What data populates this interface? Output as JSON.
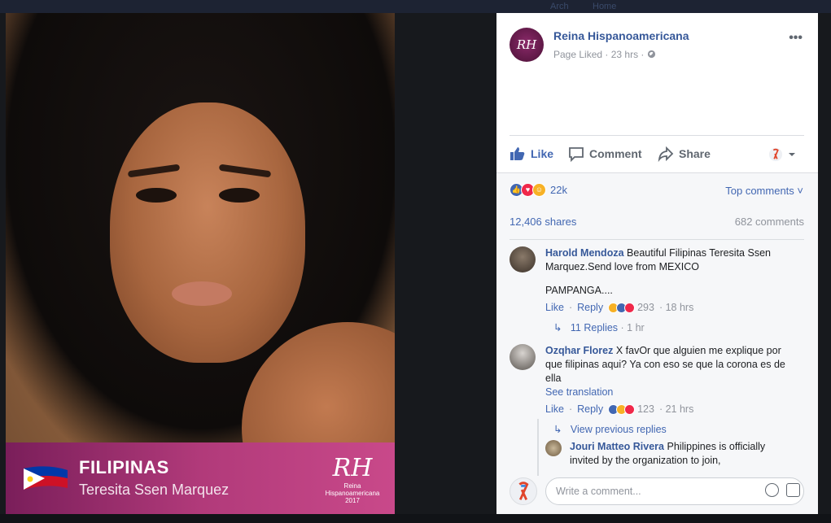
{
  "topbar": {
    "user": "Arch",
    "home": "Home"
  },
  "photo": {
    "country": "FILIPINAS",
    "person": "Teresita Ssen Marquez",
    "watermark": {
      "mono": "RH",
      "brand": "Reina Hispanoamericana",
      "year": "2017"
    }
  },
  "post": {
    "page_name": "Reina Hispanoamericana",
    "page_avatar_text": "RH",
    "meta": "Page Liked · 23 hrs · ",
    "more_label": "•••"
  },
  "actions": {
    "like": "Like",
    "comment": "Comment",
    "share": "Share"
  },
  "reactions": {
    "count": "22k",
    "top_comments": "Top comments ˅"
  },
  "counts": {
    "shares": "12,406 shares",
    "comments": "682 comments"
  },
  "comments": [
    {
      "name": "Harold Mendoza",
      "text": "Beautiful Filipinas Teresita Ssen Marquez.Send love from MEXICO",
      "text2": "PAMPANGA....",
      "like": "Like",
      "reply": "Reply",
      "reactions": "293",
      "time": "· 18 hrs",
      "replies": "11 Replies",
      "replies_time": "· 1 hr"
    },
    {
      "name": "Ozqhar Florez",
      "text": "X favOr que alguien me explique por que filipinas aqui? Ya con eso se que la corona es de ella",
      "see_translation": "See translation",
      "like": "Like",
      "reply": "Reply",
      "reactions": "123",
      "time": "· 21 hrs",
      "view_previous": "View previous replies"
    }
  ],
  "reply": {
    "name": "Jouri Matteo Rivera",
    "text": "Philippines is officially invited by the organization to join,"
  },
  "composer": {
    "placeholder": "Write a comment..."
  },
  "colors": {
    "fb_blue": "#4267b2",
    "link": "#365899",
    "banner": "#b13a7a"
  }
}
